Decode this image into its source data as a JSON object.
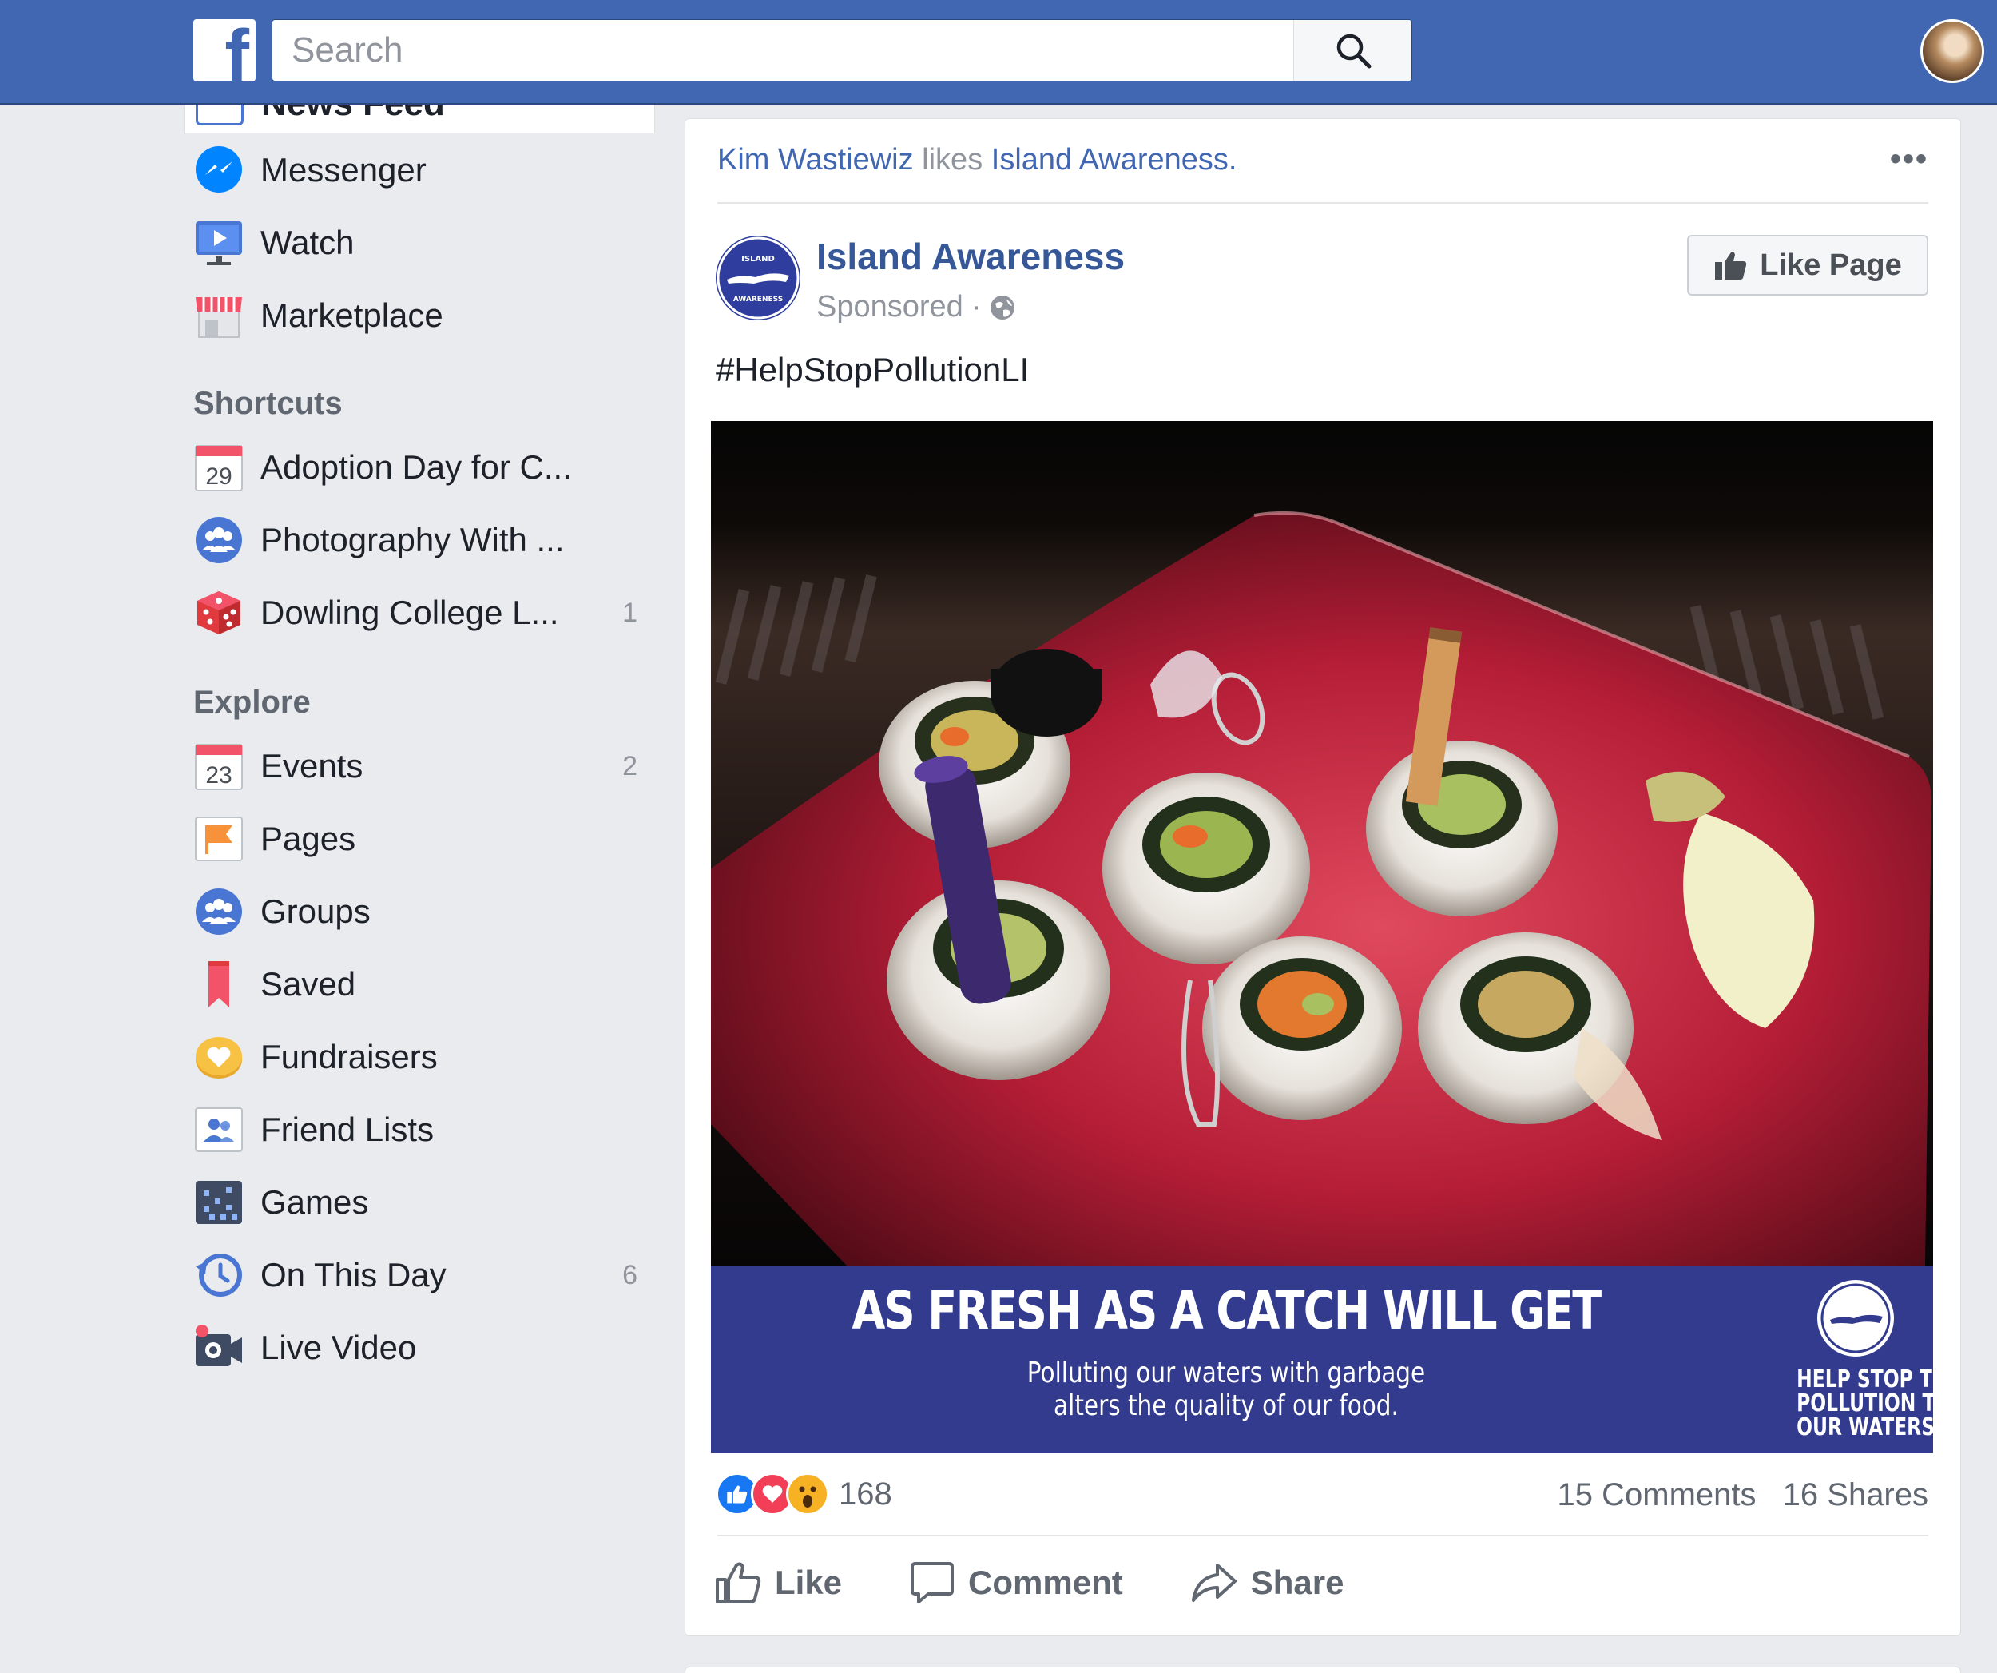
{
  "topbar": {
    "logo": "f",
    "search_placeholder": "Search"
  },
  "sidebar": {
    "news_feed_label": "News Feed",
    "main_items": [
      {
        "label": "Messenger",
        "icon": "messenger-icon"
      },
      {
        "label": "Watch",
        "icon": "watch-icon"
      },
      {
        "label": "Marketplace",
        "icon": "marketplace-icon"
      }
    ],
    "shortcuts_heading": "Shortcuts",
    "shortcuts": [
      {
        "label": "Adoption Day for C...",
        "icon": "calendar-icon",
        "icon_text": "29",
        "count": ""
      },
      {
        "label": "Photography With ...",
        "icon": "group-icon",
        "count": ""
      },
      {
        "label": "Dowling College L...",
        "icon": "dice-icon",
        "count": "1"
      }
    ],
    "explore_heading": "Explore",
    "explore": [
      {
        "label": "Events",
        "icon": "calendar-icon",
        "icon_text": "23",
        "count": "2"
      },
      {
        "label": "Pages",
        "icon": "flag-icon",
        "count": ""
      },
      {
        "label": "Groups",
        "icon": "group-icon",
        "count": ""
      },
      {
        "label": "Saved",
        "icon": "bookmark-icon",
        "count": ""
      },
      {
        "label": "Fundraisers",
        "icon": "heart-coin-icon",
        "count": ""
      },
      {
        "label": "Friend Lists",
        "icon": "friends-icon",
        "count": ""
      },
      {
        "label": "Games",
        "icon": "games-icon",
        "count": ""
      },
      {
        "label": "On This Day",
        "icon": "history-icon",
        "count": "6"
      },
      {
        "label": "Live Video",
        "icon": "live-camera-icon",
        "count": ""
      }
    ]
  },
  "post": {
    "story_actor": "Kim Wastiewiz",
    "story_verb": "likes",
    "story_target": "Island Awareness.",
    "page_name": "Island Awareness",
    "sponsored": "Sponsored",
    "like_page_label": "Like Page",
    "caption": "#HelpStopPollutionLI",
    "logo_text_top": "ISLAND",
    "logo_text_bottom": "AWARENESS",
    "banner": {
      "headline": "AS FRESH AS A CATCH WILL GET",
      "line1": "Polluting our waters with garbage",
      "line2": "alters the quality of our food.",
      "tag1": "HELP STOP THE",
      "tag2": "POLLUTION TO",
      "tag3": "OUR WATERS"
    },
    "reaction_count": "168",
    "comments": "15 Comments",
    "shares": "16 Shares",
    "actions": {
      "like": "Like",
      "comment": "Comment",
      "share": "Share"
    }
  },
  "colors": {
    "brand_blue": "#4267b2",
    "link_blue": "#365899",
    "banner_blue": "#333b8e"
  }
}
